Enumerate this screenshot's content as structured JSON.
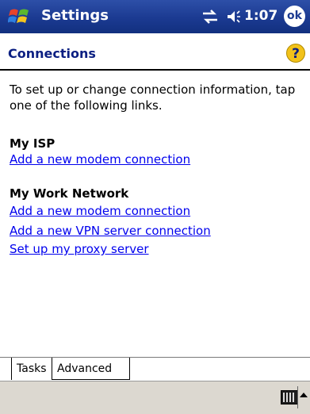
{
  "titlebar": {
    "app_title": "Settings",
    "clock": "1:07",
    "ok_label": "ok",
    "start_icon": "windows-flag-icon",
    "connectivity_icon": "connectivity-icon",
    "volume_icon": "speaker-icon"
  },
  "header": {
    "title": "Connections",
    "help_icon": "help-icon",
    "help_glyph": "?"
  },
  "content": {
    "intro": "To set up or change connection information, tap one of the following links.",
    "my_isp": {
      "heading": "My ISP",
      "links": [
        "Add a new modem connection"
      ]
    },
    "my_work_network": {
      "heading": "My Work Network",
      "links": [
        "Add a new modem connection",
        "Add a new VPN server connection",
        "Set up my proxy server"
      ]
    }
  },
  "tabs": [
    "Tasks",
    "Advanced"
  ],
  "bottombar": {
    "input_panel_icon": "keyboard-icon",
    "input_menu_icon": "up-arrow-icon"
  },
  "colors": {
    "titlebar": "#1b3a91",
    "header_text": "#0b1f82",
    "link": "#0000ee",
    "bottombar": "#dcd8d0"
  }
}
